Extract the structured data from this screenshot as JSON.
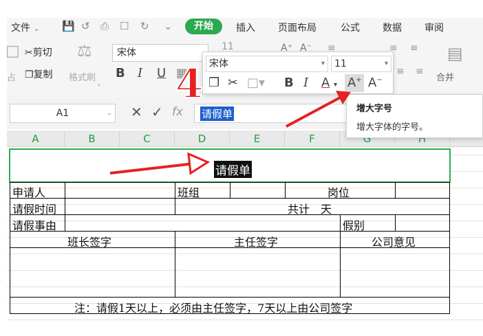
{
  "menu": {
    "file_label": "文件",
    "tabs": [
      "开始",
      "插入",
      "页面布局",
      "公式",
      "数据",
      "审阅"
    ]
  },
  "ribbon": {
    "cut_label": "剪切",
    "copy_label": "复制",
    "format_painter_label": "格式刷",
    "paste_fragment": "占",
    "font_name": "宋体",
    "font_size_partial": "11",
    "merge_label": "合并"
  },
  "formula_bar": {
    "name_box": "A1",
    "fx_label": "fx",
    "content": "请假单"
  },
  "columns": [
    "A",
    "B",
    "C",
    "D",
    "E",
    "F",
    "G",
    "H"
  ],
  "float_toolbar": {
    "font_name": "宋体",
    "font_size": "11",
    "increase_font_glyph": "A",
    "decrease_font_glyph": "A"
  },
  "tooltip": {
    "title": "增大字号",
    "description": "增大字体的字号。"
  },
  "step_number": "4",
  "sheet": {
    "title": "请假单",
    "applicant": "申请人",
    "team": "班组",
    "position": "岗位",
    "leave_time": "请假时间",
    "total": "共计　天",
    "leave_reason": "请假事由",
    "leave_type": "假别",
    "team_leader_sign": "班长签字",
    "director_sign": "主任签字",
    "company_opinion": "公司意见",
    "note": "注：请假1天以上，必须由主任签字，7天以上由公司签字"
  },
  "colors": {
    "accent": "#2da94f",
    "selection": "#1d5fcf",
    "arrow": "#e42222"
  }
}
